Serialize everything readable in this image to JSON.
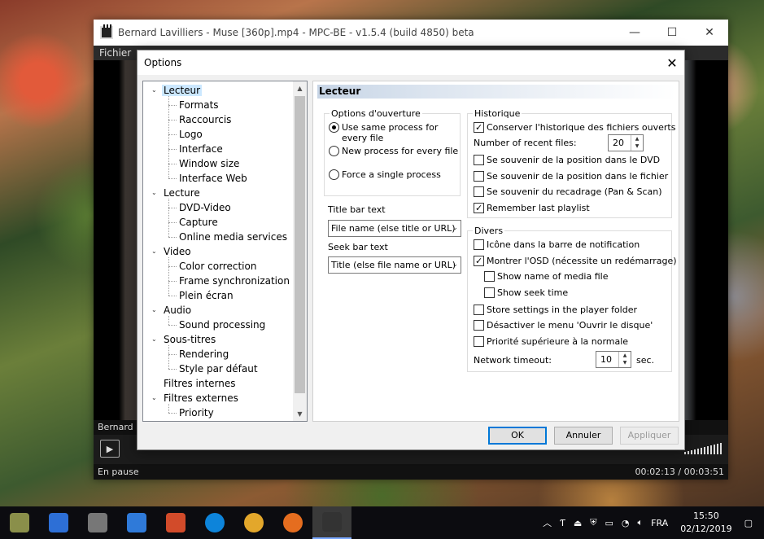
{
  "mpc": {
    "title": "Bernard Lavilliers - Muse [360p].mp4 - MPC-BE - v1.5.4 (build 4850) beta",
    "menu_first": "Fichier",
    "video_title": "Bernard L",
    "status_left": "En pause",
    "status_time": "00:02:13 / 00:03:51",
    "play_symbol": "▶"
  },
  "dialog": {
    "title": "Options",
    "close_symbol": "✕",
    "page_title": "Lecteur",
    "tree": [
      {
        "label": "Lecteur",
        "level": 0,
        "expanded": true,
        "selected": true
      },
      {
        "label": "Formats",
        "level": 1
      },
      {
        "label": "Raccourcis",
        "level": 1
      },
      {
        "label": "Logo",
        "level": 1
      },
      {
        "label": "Interface",
        "level": 1
      },
      {
        "label": "Window size",
        "level": 1
      },
      {
        "label": "Interface Web",
        "level": 1
      },
      {
        "label": "Lecture",
        "level": 0,
        "expanded": true
      },
      {
        "label": "DVD-Video",
        "level": 1
      },
      {
        "label": "Capture",
        "level": 1
      },
      {
        "label": "Online media services",
        "level": 1
      },
      {
        "label": "Video",
        "level": 0,
        "expanded": true
      },
      {
        "label": "Color correction",
        "level": 1
      },
      {
        "label": "Frame synchronization",
        "level": 1
      },
      {
        "label": "Plein écran",
        "level": 1
      },
      {
        "label": "Audio",
        "level": 0,
        "expanded": true
      },
      {
        "label": "Sound processing",
        "level": 1
      },
      {
        "label": "Sous-titres",
        "level": 0,
        "expanded": true
      },
      {
        "label": "Rendering",
        "level": 1
      },
      {
        "label": "Style par défaut",
        "level": 1
      },
      {
        "label": "Filtres internes",
        "level": 0
      },
      {
        "label": "Filtres externes",
        "level": 0,
        "expanded": true
      },
      {
        "label": "Priority",
        "level": 1
      }
    ],
    "open_options": {
      "legend": "Options d'ouverture",
      "radios": [
        {
          "label": "Use same process for every file",
          "checked": true
        },
        {
          "label": "New process for every file",
          "checked": false
        },
        {
          "label": "Force a single process",
          "checked": false
        }
      ]
    },
    "title_bar": {
      "label": "Title bar text",
      "value": "File name (else title or URL)"
    },
    "seek_bar": {
      "label": "Seek bar text",
      "value": "Title (else file name or URL)"
    },
    "history": {
      "legend": "Historique",
      "keep_history": {
        "label": "Conserver l'historique des fichiers ouverts",
        "checked": true
      },
      "recent_label": "Number of recent files:",
      "recent_value": "20",
      "dvd_pos": {
        "label": "Se souvenir de la position dans le DVD",
        "checked": false
      },
      "file_pos": {
        "label": "Se souvenir de la position dans le fichier",
        "checked": false
      },
      "pan_scan": {
        "label": "Se souvenir du recadrage (Pan & Scan)",
        "checked": false
      },
      "last_playlist": {
        "label": "Remember last playlist",
        "checked": true
      }
    },
    "misc": {
      "legend": "Divers",
      "tray_icon": {
        "label": "Icône dans la barre de notification",
        "checked": false
      },
      "osd": {
        "label": "Montrer l'OSD (nécessite un redémarrage)",
        "checked": true
      },
      "show_name": {
        "label": "Show name of media file",
        "checked": false
      },
      "show_seek": {
        "label": "Show seek time",
        "checked": false
      },
      "store_settings": {
        "label": "Store settings in the player folder",
        "checked": false
      },
      "disable_menu": {
        "label": "Désactiver le menu 'Ouvrir le disque'",
        "checked": false
      },
      "priority": {
        "label": "Priorité supérieure à la normale",
        "checked": false
      },
      "timeout_label": "Network timeout:",
      "timeout_value": "10",
      "timeout_unit": "sec."
    },
    "buttons": {
      "ok": "OK",
      "cancel": "Annuler",
      "apply": "Appliquer"
    }
  },
  "taskbar": {
    "language": "FRA",
    "time": "15:50",
    "date": "02/12/2019",
    "app_icons": [
      "tbshot-icon",
      "video-app-icon",
      "disk-utility-icon",
      "malwarebytes-icon",
      "ccleaner-icon",
      "edge-icon",
      "chrome-icon",
      "firefox-icon",
      "mpc-be-icon"
    ],
    "icon_colors": [
      "#8a8f4a",
      "#2d6fd6",
      "#777777",
      "#2f7ad9",
      "#d24b2a",
      "#0d84da",
      "#e3a72b",
      "#e56d1f",
      "#333333"
    ]
  }
}
